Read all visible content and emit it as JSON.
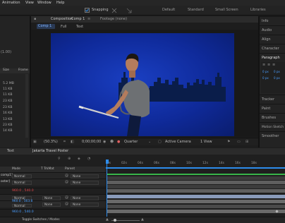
{
  "menu": [
    "Animation",
    "View",
    "Window",
    "Help"
  ],
  "toolbar": {
    "snapping": "Snapping",
    "workspaces": [
      "Default",
      "Standard",
      "Small Screen",
      "Libraries"
    ]
  },
  "left_panel": {
    "partial_values": [
      "(1.00)"
    ],
    "col_size": "Size",
    "col_frame": "Frame",
    "sizes": [
      "5.2 MB",
      "11 KB",
      "11 KB",
      "23 KB",
      "23 KB",
      "16 KB",
      "13 KB",
      "23 KB",
      "14 KB"
    ]
  },
  "composition": {
    "panel_label": "Composition",
    "comp_name": "Comp 1",
    "footage_label": "Footage (none)",
    "breadcrumbs": [
      "Comp 1",
      "Full",
      "Text"
    ]
  },
  "viewer_bar": {
    "zoom": "(50.3%)",
    "timecode": "0;00;00;00",
    "resolution": "Quarter",
    "camera": "Active Camera",
    "views": "1 View"
  },
  "right_panel": {
    "items": [
      "Info",
      "Audio",
      "Align",
      "Character",
      "Paragraph",
      "Tracker",
      "Paint",
      "Brushes",
      "Motion Sketch",
      "Smoother"
    ],
    "active": "Paragraph",
    "spacing_fields": [
      "0 px",
      "0 px",
      "0 px",
      "0 px"
    ]
  },
  "timeline": {
    "tabs": [
      "Text",
      "Jakarta Travel Poster"
    ],
    "columns": {
      "mode": "Mode",
      "trkmat": "T TrkMat",
      "parent": "Parent"
    },
    "ruler": [
      "0s",
      "02s",
      "04s",
      "06s",
      "08s",
      "10s",
      "12s",
      "14s",
      "16s",
      "18s"
    ],
    "rows": [
      {
        "name": "comp1]",
        "mode": "Normal",
        "parent": "None"
      },
      {
        "name": "oster]",
        "mode": "Normal",
        "parent": "None"
      },
      {
        "value": "960.0 , 540.0",
        "mode": "",
        "parent": ""
      },
      {
        "value": "",
        "mode": "Normal",
        "trkmat": "None",
        "parent": "None"
      },
      {
        "value": "960.0 , 563.8",
        "mode": "Normal",
        "trkmat": "None",
        "parent": "None"
      },
      {
        "value": "960.0 , 540.0",
        "mode": "",
        "parent": ""
      }
    ],
    "footer": "Toggle Switches / Modes"
  },
  "colors": {
    "accent": "#2d8ceb",
    "canvas": "#1436b0",
    "red_value": "#e0464a",
    "green_track": "#39b54a",
    "blue_value": "#4a9eff"
  }
}
